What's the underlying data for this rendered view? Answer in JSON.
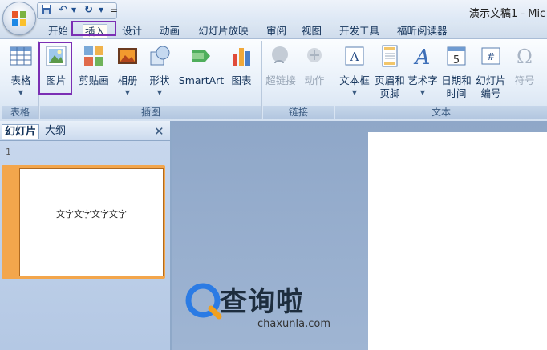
{
  "window": {
    "title": "演示文稿1 - Mic"
  },
  "qat": {
    "save_icon": "save-icon",
    "undo_icon": "undo-icon",
    "redo_icon": "redo-icon",
    "dropdown": "="
  },
  "tabs": [
    "开始",
    "插入",
    "设计",
    "动画",
    "幻灯片放映",
    "审阅",
    "视图",
    "开发工具",
    "福昕阅读器"
  ],
  "active_tab": "插入",
  "ribbon": {
    "groups": {
      "tables": "表格",
      "illustrations": "插图",
      "links": "链接",
      "text": "文本"
    },
    "buttons": {
      "table": "表格",
      "picture": "图片",
      "clipart": "剪贴画",
      "album": "相册",
      "shapes": "形状",
      "smartart": "SmartArt",
      "chart": "图表",
      "hyperlink": "超链接",
      "action": "动作",
      "textbox": "文本框",
      "header_footer_1": "页眉和",
      "header_footer_2": "页脚",
      "wordart": "艺术字",
      "datetime_1": "日期和",
      "datetime_2": "时间",
      "slide_number_1": "幻灯片",
      "slide_number_2": "编号",
      "symbol": "符号",
      "date_icon_number": "5"
    }
  },
  "pane": {
    "tab_slides": "幻灯片",
    "tab_outline": "大纲",
    "close": "✕",
    "slide_number": "1",
    "thumbnail_text": "文字文字文字文字"
  },
  "watermark": {
    "text": "查询啦",
    "sub": "chaxunla.com"
  },
  "colors": {
    "highlight": "#7b2fb4",
    "ribbon_bg": "#e8f0f9",
    "thumb_selected": "#f3a64c"
  }
}
